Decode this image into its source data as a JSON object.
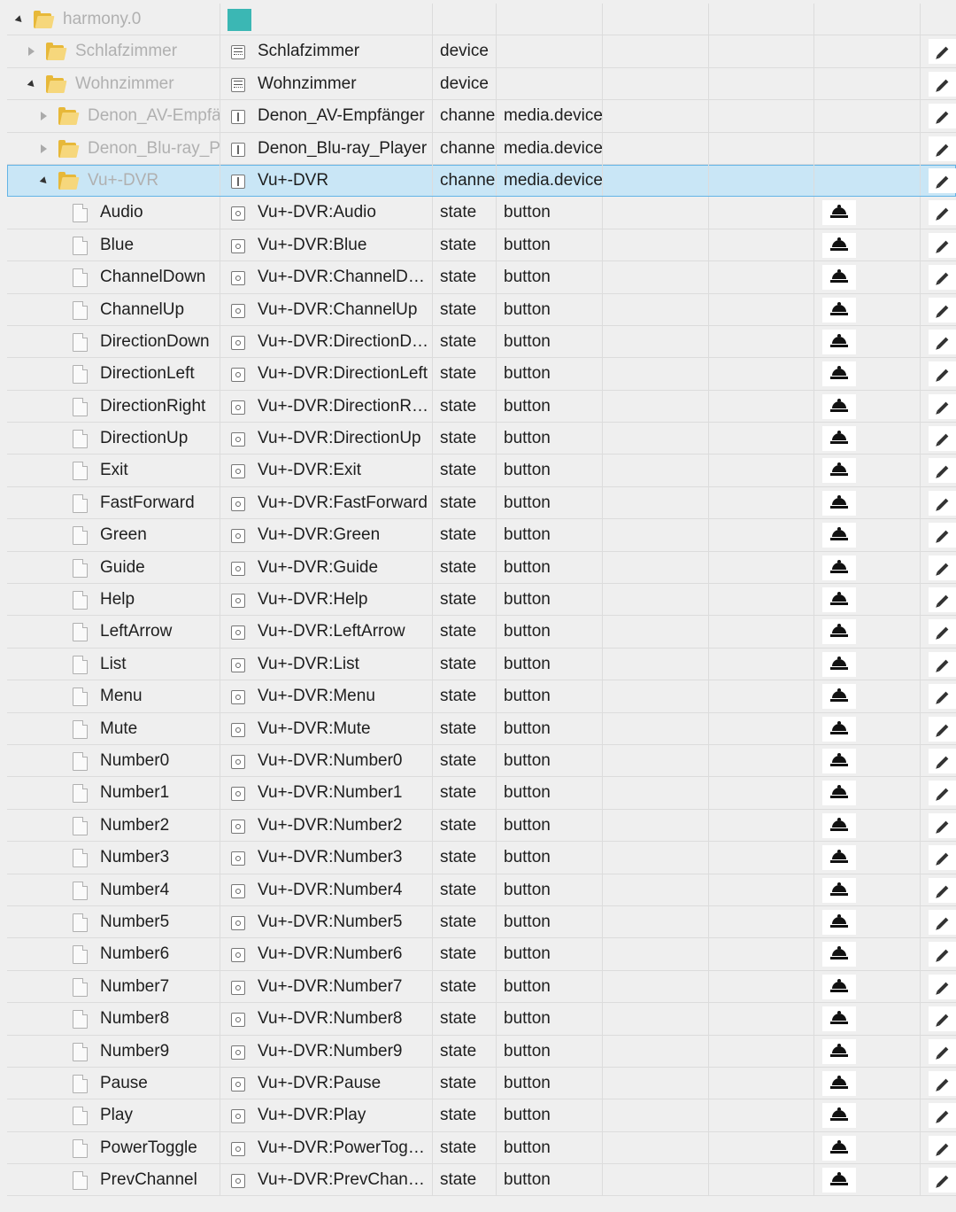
{
  "tree": [
    {
      "level": 0,
      "toggle": "expanded",
      "icon": "folder",
      "name": "harmony.0",
      "name_grey": true,
      "id_icon": "thumb",
      "id": "",
      "type": "",
      "role": "",
      "button": false,
      "edit": false,
      "selected": false
    },
    {
      "level": 1,
      "toggle": "collapsed",
      "icon": "folder",
      "name": "Schlafzimmer",
      "name_grey": true,
      "id_icon": "device",
      "id": "Schlafzimmer",
      "type": "device",
      "role": "",
      "button": false,
      "edit": true,
      "selected": false
    },
    {
      "level": 1,
      "toggle": "expanded",
      "icon": "folder",
      "name": "Wohnzimmer",
      "name_grey": true,
      "id_icon": "device",
      "id": "Wohnzimmer",
      "type": "device",
      "role": "",
      "button": false,
      "edit": true,
      "selected": false
    },
    {
      "level": 2,
      "toggle": "collapsed",
      "icon": "folder",
      "name": "Denon_AV-Empfänger",
      "name_grey": true,
      "id_icon": "channel",
      "id": "Denon_AV-Empfänger",
      "type": "channel",
      "role": "media.device",
      "button": false,
      "edit": true,
      "selected": false
    },
    {
      "level": 2,
      "toggle": "collapsed",
      "icon": "folder",
      "name": "Denon_Blu-ray_Player",
      "name_grey": true,
      "id_icon": "channel",
      "id": "Denon_Blu-ray_Player",
      "type": "channel",
      "role": "media.device",
      "button": false,
      "edit": true,
      "selected": false
    },
    {
      "level": 2,
      "toggle": "expanded",
      "icon": "folder",
      "name": "Vu+-DVR",
      "name_grey": true,
      "id_icon": "channel",
      "id": "Vu+-DVR",
      "type": "channel",
      "role": "media.device",
      "button": false,
      "edit": true,
      "selected": true
    },
    {
      "level": 3,
      "toggle": "none",
      "icon": "file",
      "name": "Audio",
      "name_grey": false,
      "id_icon": "state",
      "id": "Vu+-DVR:Audio",
      "type": "state",
      "role": "button",
      "button": true,
      "edit": true,
      "selected": false
    },
    {
      "level": 3,
      "toggle": "none",
      "icon": "file",
      "name": "Blue",
      "name_grey": false,
      "id_icon": "state",
      "id": "Vu+-DVR:Blue",
      "type": "state",
      "role": "button",
      "button": true,
      "edit": true,
      "selected": false
    },
    {
      "level": 3,
      "toggle": "none",
      "icon": "file",
      "name": "ChannelDown",
      "name_grey": false,
      "id_icon": "state",
      "id": "Vu+-DVR:ChannelDown",
      "type": "state",
      "role": "button",
      "button": true,
      "edit": true,
      "selected": false
    },
    {
      "level": 3,
      "toggle": "none",
      "icon": "file",
      "name": "ChannelUp",
      "name_grey": false,
      "id_icon": "state",
      "id": "Vu+-DVR:ChannelUp",
      "type": "state",
      "role": "button",
      "button": true,
      "edit": true,
      "selected": false
    },
    {
      "level": 3,
      "toggle": "none",
      "icon": "file",
      "name": "DirectionDown",
      "name_grey": false,
      "id_icon": "state",
      "id": "Vu+-DVR:DirectionDown",
      "type": "state",
      "role": "button",
      "button": true,
      "edit": true,
      "selected": false
    },
    {
      "level": 3,
      "toggle": "none",
      "icon": "file",
      "name": "DirectionLeft",
      "name_grey": false,
      "id_icon": "state",
      "id": "Vu+-DVR:DirectionLeft",
      "type": "state",
      "role": "button",
      "button": true,
      "edit": true,
      "selected": false
    },
    {
      "level": 3,
      "toggle": "none",
      "icon": "file",
      "name": "DirectionRight",
      "name_grey": false,
      "id_icon": "state",
      "id": "Vu+-DVR:DirectionRight",
      "type": "state",
      "role": "button",
      "button": true,
      "edit": true,
      "selected": false
    },
    {
      "level": 3,
      "toggle": "none",
      "icon": "file",
      "name": "DirectionUp",
      "name_grey": false,
      "id_icon": "state",
      "id": "Vu+-DVR:DirectionUp",
      "type": "state",
      "role": "button",
      "button": true,
      "edit": true,
      "selected": false
    },
    {
      "level": 3,
      "toggle": "none",
      "icon": "file",
      "name": "Exit",
      "name_grey": false,
      "id_icon": "state",
      "id": "Vu+-DVR:Exit",
      "type": "state",
      "role": "button",
      "button": true,
      "edit": true,
      "selected": false
    },
    {
      "level": 3,
      "toggle": "none",
      "icon": "file",
      "name": "FastForward",
      "name_grey": false,
      "id_icon": "state",
      "id": "Vu+-DVR:FastForward",
      "type": "state",
      "role": "button",
      "button": true,
      "edit": true,
      "selected": false
    },
    {
      "level": 3,
      "toggle": "none",
      "icon": "file",
      "name": "Green",
      "name_grey": false,
      "id_icon": "state",
      "id": "Vu+-DVR:Green",
      "type": "state",
      "role": "button",
      "button": true,
      "edit": true,
      "selected": false
    },
    {
      "level": 3,
      "toggle": "none",
      "icon": "file",
      "name": "Guide",
      "name_grey": false,
      "id_icon": "state",
      "id": "Vu+-DVR:Guide",
      "type": "state",
      "role": "button",
      "button": true,
      "edit": true,
      "selected": false
    },
    {
      "level": 3,
      "toggle": "none",
      "icon": "file",
      "name": "Help",
      "name_grey": false,
      "id_icon": "state",
      "id": "Vu+-DVR:Help",
      "type": "state",
      "role": "button",
      "button": true,
      "edit": true,
      "selected": false
    },
    {
      "level": 3,
      "toggle": "none",
      "icon": "file",
      "name": "LeftArrow",
      "name_grey": false,
      "id_icon": "state",
      "id": "Vu+-DVR:LeftArrow",
      "type": "state",
      "role": "button",
      "button": true,
      "edit": true,
      "selected": false
    },
    {
      "level": 3,
      "toggle": "none",
      "icon": "file",
      "name": "List",
      "name_grey": false,
      "id_icon": "state",
      "id": "Vu+-DVR:List",
      "type": "state",
      "role": "button",
      "button": true,
      "edit": true,
      "selected": false
    },
    {
      "level": 3,
      "toggle": "none",
      "icon": "file",
      "name": "Menu",
      "name_grey": false,
      "id_icon": "state",
      "id": "Vu+-DVR:Menu",
      "type": "state",
      "role": "button",
      "button": true,
      "edit": true,
      "selected": false
    },
    {
      "level": 3,
      "toggle": "none",
      "icon": "file",
      "name": "Mute",
      "name_grey": false,
      "id_icon": "state",
      "id": "Vu+-DVR:Mute",
      "type": "state",
      "role": "button",
      "button": true,
      "edit": true,
      "selected": false
    },
    {
      "level": 3,
      "toggle": "none",
      "icon": "file",
      "name": "Number0",
      "name_grey": false,
      "id_icon": "state",
      "id": "Vu+-DVR:Number0",
      "type": "state",
      "role": "button",
      "button": true,
      "edit": true,
      "selected": false
    },
    {
      "level": 3,
      "toggle": "none",
      "icon": "file",
      "name": "Number1",
      "name_grey": false,
      "id_icon": "state",
      "id": "Vu+-DVR:Number1",
      "type": "state",
      "role": "button",
      "button": true,
      "edit": true,
      "selected": false
    },
    {
      "level": 3,
      "toggle": "none",
      "icon": "file",
      "name": "Number2",
      "name_grey": false,
      "id_icon": "state",
      "id": "Vu+-DVR:Number2",
      "type": "state",
      "role": "button",
      "button": true,
      "edit": true,
      "selected": false
    },
    {
      "level": 3,
      "toggle": "none",
      "icon": "file",
      "name": "Number3",
      "name_grey": false,
      "id_icon": "state",
      "id": "Vu+-DVR:Number3",
      "type": "state",
      "role": "button",
      "button": true,
      "edit": true,
      "selected": false
    },
    {
      "level": 3,
      "toggle": "none",
      "icon": "file",
      "name": "Number4",
      "name_grey": false,
      "id_icon": "state",
      "id": "Vu+-DVR:Number4",
      "type": "state",
      "role": "button",
      "button": true,
      "edit": true,
      "selected": false
    },
    {
      "level": 3,
      "toggle": "none",
      "icon": "file",
      "name": "Number5",
      "name_grey": false,
      "id_icon": "state",
      "id": "Vu+-DVR:Number5",
      "type": "state",
      "role": "button",
      "button": true,
      "edit": true,
      "selected": false
    },
    {
      "level": 3,
      "toggle": "none",
      "icon": "file",
      "name": "Number6",
      "name_grey": false,
      "id_icon": "state",
      "id": "Vu+-DVR:Number6",
      "type": "state",
      "role": "button",
      "button": true,
      "edit": true,
      "selected": false
    },
    {
      "level": 3,
      "toggle": "none",
      "icon": "file",
      "name": "Number7",
      "name_grey": false,
      "id_icon": "state",
      "id": "Vu+-DVR:Number7",
      "type": "state",
      "role": "button",
      "button": true,
      "edit": true,
      "selected": false
    },
    {
      "level": 3,
      "toggle": "none",
      "icon": "file",
      "name": "Number8",
      "name_grey": false,
      "id_icon": "state",
      "id": "Vu+-DVR:Number8",
      "type": "state",
      "role": "button",
      "button": true,
      "edit": true,
      "selected": false
    },
    {
      "level": 3,
      "toggle": "none",
      "icon": "file",
      "name": "Number9",
      "name_grey": false,
      "id_icon": "state",
      "id": "Vu+-DVR:Number9",
      "type": "state",
      "role": "button",
      "button": true,
      "edit": true,
      "selected": false
    },
    {
      "level": 3,
      "toggle": "none",
      "icon": "file",
      "name": "Pause",
      "name_grey": false,
      "id_icon": "state",
      "id": "Vu+-DVR:Pause",
      "type": "state",
      "role": "button",
      "button": true,
      "edit": true,
      "selected": false
    },
    {
      "level": 3,
      "toggle": "none",
      "icon": "file",
      "name": "Play",
      "name_grey": false,
      "id_icon": "state",
      "id": "Vu+-DVR:Play",
      "type": "state",
      "role": "button",
      "button": true,
      "edit": true,
      "selected": false
    },
    {
      "level": 3,
      "toggle": "none",
      "icon": "file",
      "name": "PowerToggle",
      "name_grey": false,
      "id_icon": "state",
      "id": "Vu+-DVR:PowerToggle",
      "type": "state",
      "role": "button",
      "button": true,
      "edit": true,
      "selected": false
    },
    {
      "level": 3,
      "toggle": "none",
      "icon": "file",
      "name": "PrevChannel",
      "name_grey": false,
      "id_icon": "state",
      "id": "Vu+-DVR:PrevChannel",
      "type": "state",
      "role": "button",
      "button": true,
      "edit": true,
      "selected": false
    }
  ],
  "icons": {
    "folder": "folder-icon",
    "file": "file-icon",
    "device": "device-icon",
    "channel": "channel-icon",
    "state": "state-icon",
    "thumb": "adapter-logo-icon",
    "button_action": "bell-icon",
    "edit": "pencil-icon"
  },
  "colors": {
    "background": "#efefef",
    "grid_line": "#dcdcdc",
    "selected_bg": "#c9e6f6",
    "selected_border": "#64b4e6",
    "folder": "#e7b839",
    "adapter_logo": "#3bb7b4",
    "grey_text": "#b0b0b0"
  }
}
